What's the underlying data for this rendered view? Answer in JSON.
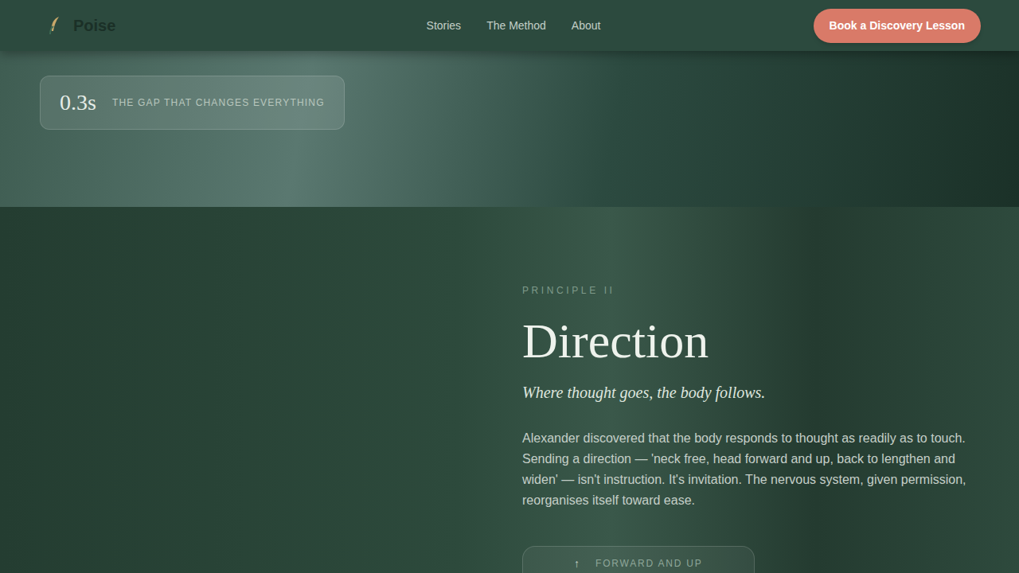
{
  "nav": {
    "logo": "Poise",
    "links": [
      {
        "label": "Stories",
        "selected": false
      },
      {
        "label": "The Method",
        "selected": false
      },
      {
        "label": "About",
        "selected": false
      }
    ],
    "cta": "Book a Discovery Lesson"
  },
  "hero": {
    "stat": {
      "value": "0.3s",
      "label": "THE GAP THAT CHANGES EVERYTHING"
    }
  },
  "principle": {
    "eyebrow": "PRINCIPLE II",
    "title": "Direction",
    "subtitle": "Where thought goes, the body follows.",
    "body": "Alexander discovered that the body responds to thought as readily as to touch. Sending a direction — 'neck free, head forward and up, back to lengthen and widen' — isn't instruction. It's invitation. The nervous system, given permission, reorganises itself toward ease.",
    "cue": {
      "icon": "↑",
      "label": "FORWARD AND UP"
    }
  }
}
